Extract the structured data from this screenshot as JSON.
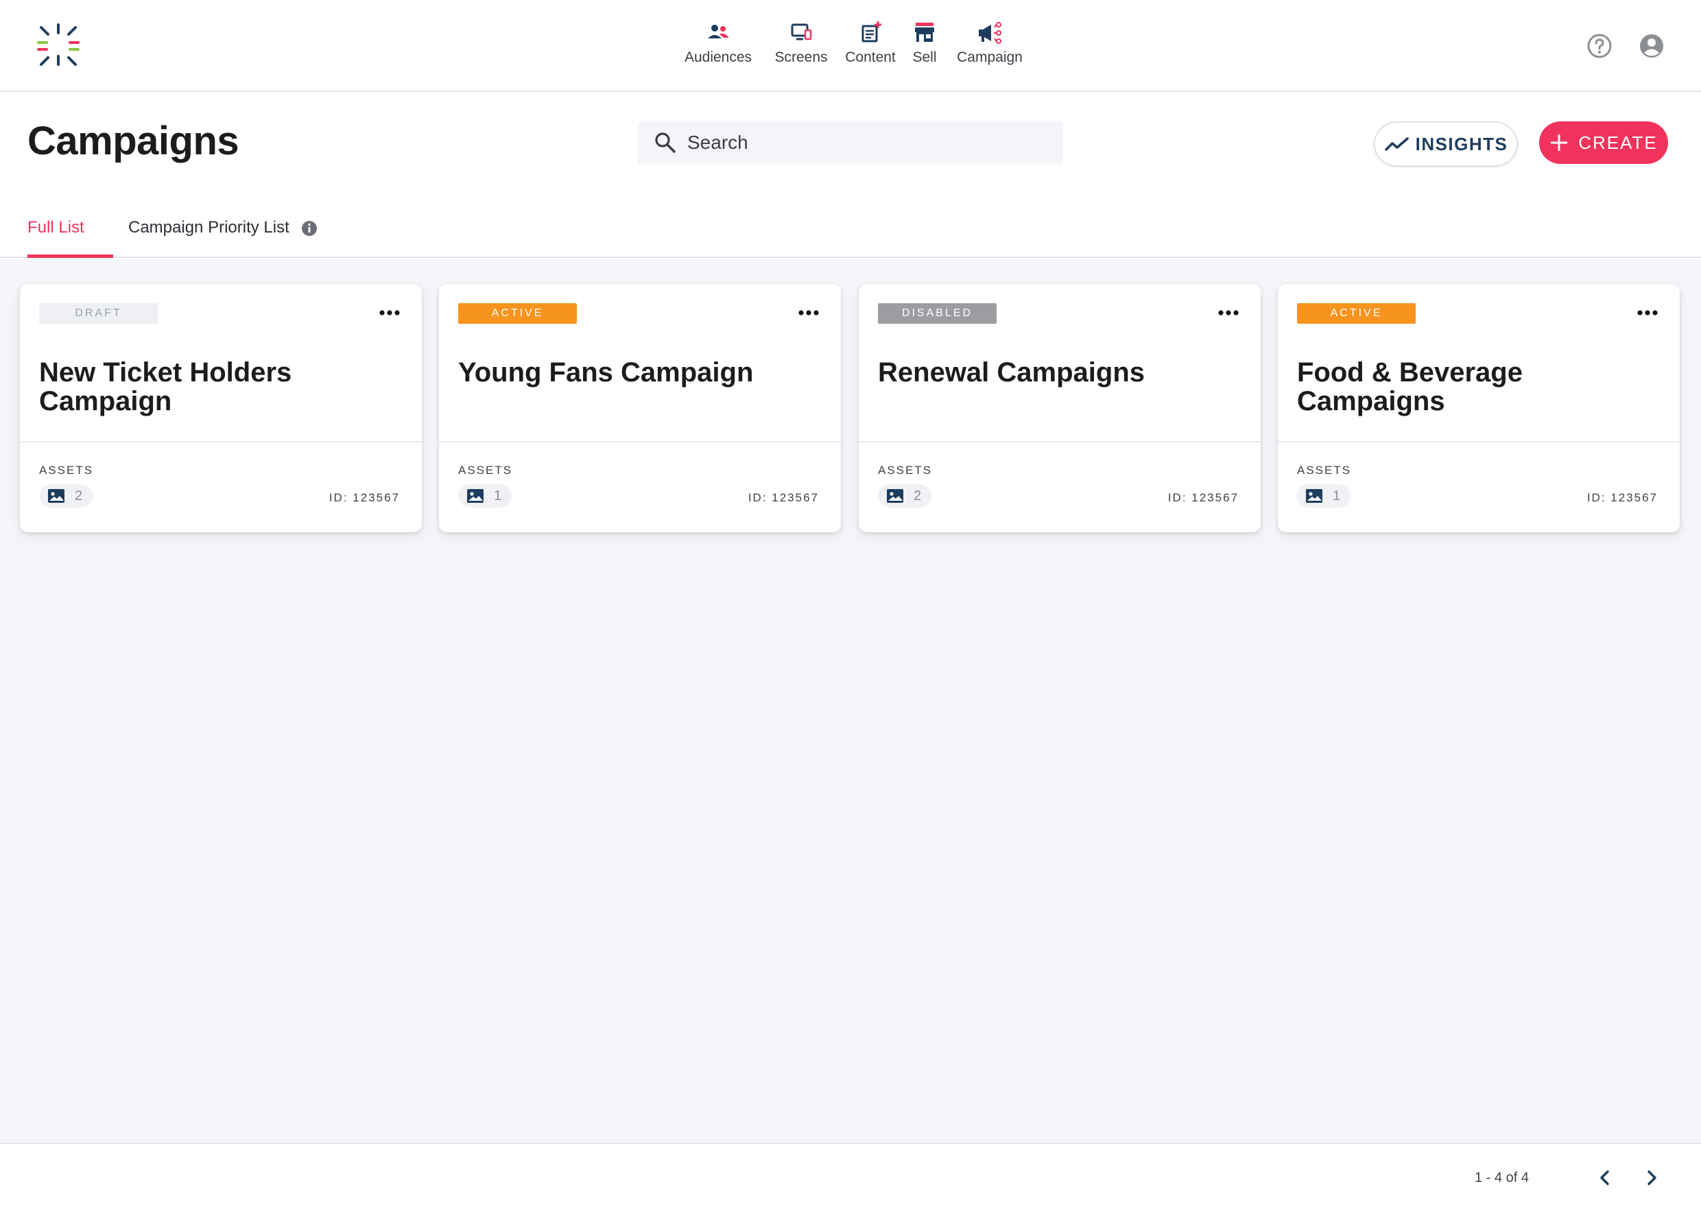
{
  "colors": {
    "accent": "#f0325c",
    "navy": "#1d3c5e",
    "active_badge": "#f7941d",
    "disabled_badge": "#9b9da1",
    "draft_badge": "#eef0f4",
    "content_bg": "#f4f5f8"
  },
  "topnav": {
    "logo": "starburst-logo-icon",
    "items": [
      {
        "label": "Audiences",
        "icon": "audiences-icon"
      },
      {
        "label": "Screens",
        "icon": "screens-icon"
      },
      {
        "label": "Content",
        "icon": "content-icon"
      },
      {
        "label": "Sell",
        "icon": "store-icon"
      },
      {
        "label": "Campaign",
        "icon": "campaign-megaphone-icon"
      }
    ],
    "right_icons": [
      "help-icon",
      "user-account-icon"
    ]
  },
  "header": {
    "title": "Campaigns",
    "search_placeholder": "Search",
    "search_value": "",
    "insights_label": "INSIGHTS",
    "create_label": "CREATE"
  },
  "tabs": [
    {
      "label": "Full List",
      "selected": true
    },
    {
      "label": "Campaign Priority List",
      "selected": false
    }
  ],
  "cards": [
    {
      "status": "DRAFT",
      "title": "New Ticket Holders Campaign",
      "assets_label": "ASSETS",
      "assets_count": "2",
      "id_text": "ID: 123567"
    },
    {
      "status": "ACTIVE",
      "title": "Young Fans Campaign",
      "assets_label": "ASSETS",
      "assets_count": "1",
      "id_text": "ID: 123567"
    },
    {
      "status": "DISABLED",
      "title": "Renewal Campaigns",
      "assets_label": "ASSETS",
      "assets_count": "2",
      "id_text": "ID: 123567"
    },
    {
      "status": "ACTIVE",
      "title": "Food & Beverage Campaigns",
      "assets_label": "ASSETS",
      "assets_count": "1",
      "id_text": "ID: 123567"
    }
  ],
  "pagination": {
    "text": "1 - 4 of 4"
  }
}
